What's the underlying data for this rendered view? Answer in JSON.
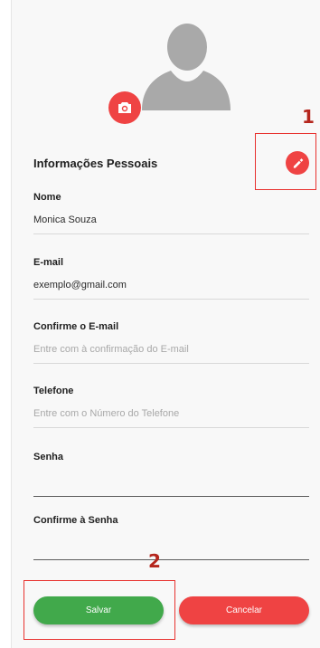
{
  "profile": {
    "section_title": "Informações Pessoais"
  },
  "fields": {
    "nome": {
      "label": "Nome",
      "value": "Monica Souza",
      "placeholder": ""
    },
    "email": {
      "label": "E-mail",
      "value": "exemplo@gmail.com",
      "placeholder": ""
    },
    "confirm_email": {
      "label": "Confirme o E-mail",
      "value": "",
      "placeholder": "Entre com à confirmação do E-mail"
    },
    "telefone": {
      "label": "Telefone",
      "value": "",
      "placeholder": "Entre com o Número do Telefone"
    },
    "senha": {
      "label": "Senha",
      "value": "",
      "placeholder": ""
    },
    "confirm_senha": {
      "label": "Confirme à Senha",
      "value": "",
      "placeholder": ""
    }
  },
  "buttons": {
    "save_label": "Salvar",
    "cancel_label": "Cancelar"
  },
  "annotations": {
    "edit_marker": "1",
    "save_marker": "2"
  },
  "colors": {
    "accent_red": "#ef4343",
    "save_green": "#41a94b",
    "annotation_red": "#e8322f"
  },
  "icons": {
    "avatar": "user-silhouette-icon",
    "camera": "camera-icon",
    "edit": "pencil-icon"
  }
}
